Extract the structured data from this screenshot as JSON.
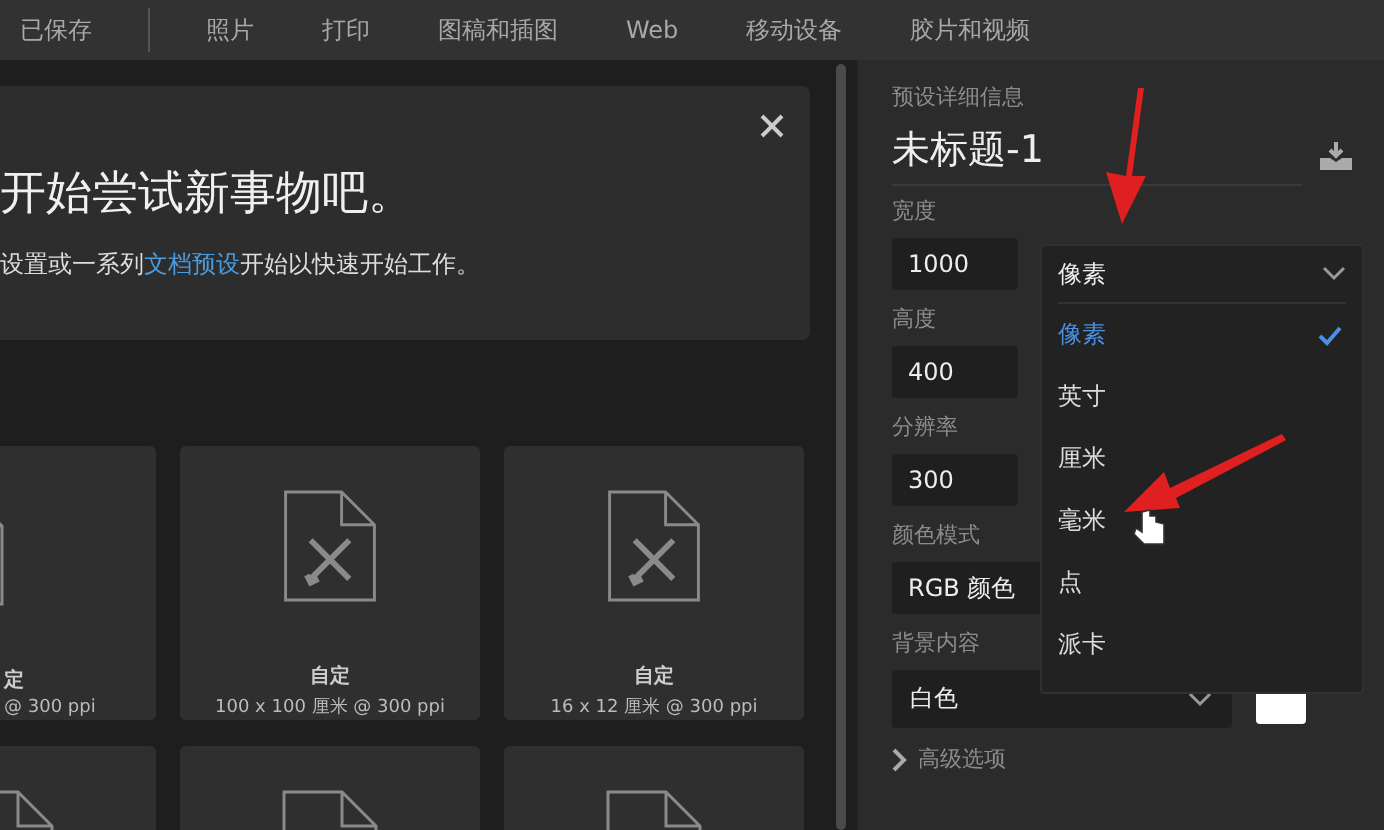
{
  "top_tabs": [
    {
      "label": "已保存",
      "selected": false
    },
    {
      "label": "照片",
      "selected": false
    },
    {
      "label": "打印",
      "selected": false
    },
    {
      "label": "图稿和插图",
      "selected": false
    },
    {
      "label": "Web",
      "selected": false
    },
    {
      "label": "移动设备",
      "selected": false
    },
    {
      "label": "胶片和视频",
      "selected": false
    }
  ],
  "banner": {
    "headline": "开始尝试新事物吧。",
    "text_before": "设置或一系列",
    "link": "文档预设",
    "text_after": "开始以快速开始工作。"
  },
  "presets": [
    {
      "kind": "clipped",
      "name": "定",
      "size": "@ 300 ppi"
    },
    {
      "kind": "custom",
      "name": "自定",
      "size": "100 x 100 厘米 @ 300 ppi"
    },
    {
      "kind": "custom",
      "name": "自定",
      "size": "16 x 12 厘米 @ 300 ppi"
    },
    {
      "kind": "blank"
    },
    {
      "kind": "blank"
    },
    {
      "kind": "blank"
    }
  ],
  "details": {
    "heading": "预设详细信息",
    "doc_name": "未标题-1",
    "width": {
      "label": "宽度",
      "value": "1000"
    },
    "height": {
      "label": "高度",
      "value": "400"
    },
    "resolution": {
      "label": "分辨率",
      "value": "300"
    },
    "color_mode": {
      "label": "颜色模式",
      "value": "RGB 颜色"
    },
    "background": {
      "label": "背景内容",
      "value": "白色"
    },
    "advanced": {
      "label": "高级选项",
      "expanded": false
    },
    "unit_dropdown": {
      "value": "像素",
      "expanded": true,
      "options": [
        {
          "label": "像素",
          "selected": true
        },
        {
          "label": "英寸",
          "selected": false
        },
        {
          "label": "厘米",
          "selected": false
        },
        {
          "label": "毫米",
          "selected": false
        },
        {
          "label": "点",
          "selected": false
        },
        {
          "label": "派卡",
          "selected": false
        }
      ]
    }
  }
}
